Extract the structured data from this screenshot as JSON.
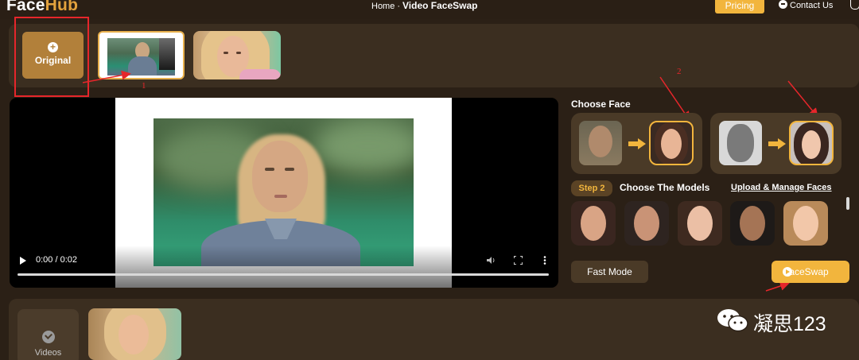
{
  "header": {
    "logo_face": "Face",
    "logo_hub": "Hub",
    "breadcrumb_home": "Home",
    "breadcrumb_sep": "·",
    "breadcrumb_current": "Video FaceSwap",
    "pricing_label": "Pricing",
    "contact_label": "Contact Us"
  },
  "top_strip": {
    "original_label": "Original"
  },
  "annotations": {
    "one": "1",
    "two": "2"
  },
  "player": {
    "time_display": "0:00 / 0:02"
  },
  "right_panel": {
    "choose_face_title": "Choose Face",
    "step_badge": "Step 2",
    "models_title": "Choose The Models",
    "manage_link": "Upload & Manage Faces",
    "fast_mode_label": "Fast Mode",
    "faceswap_label": "FaceSwap"
  },
  "bottom": {
    "videos_label": "Videos"
  },
  "watermark": {
    "text": "凝思123"
  },
  "colors": {
    "accent": "#f2b53d",
    "background": "#2b2016",
    "panel": "#3b2e20",
    "annotation_red": "#e6262b"
  }
}
